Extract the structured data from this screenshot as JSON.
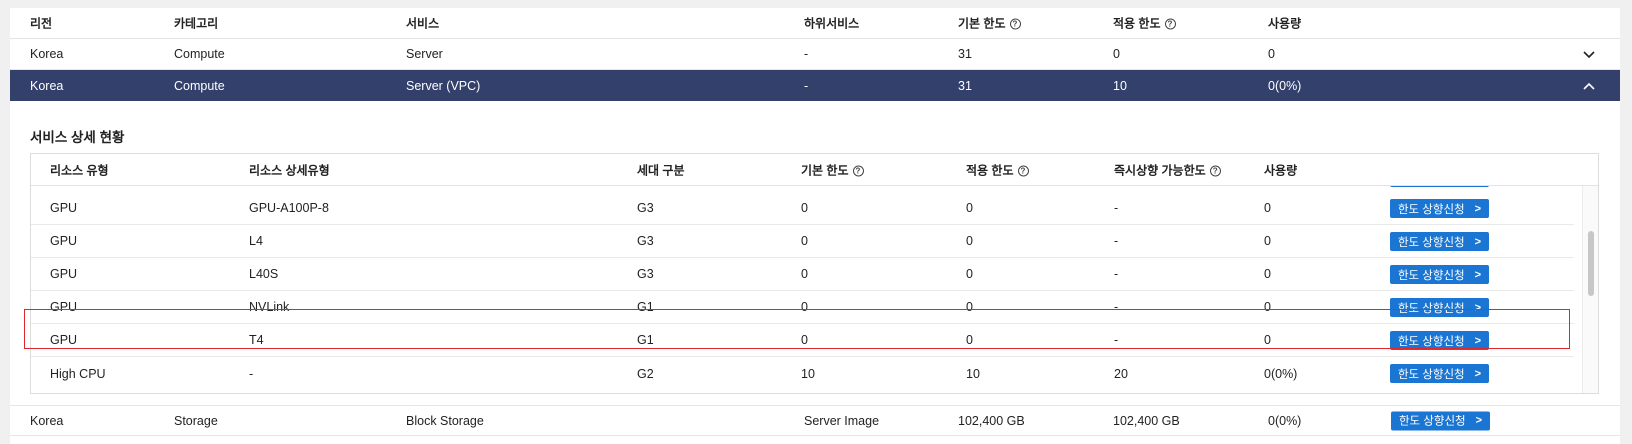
{
  "main_table": {
    "headers": {
      "region": "리전",
      "category": "카테고리",
      "service": "서비스",
      "sub_service": "하위서비스",
      "base_limit": "기본 한도",
      "applied_limit": "적용 한도",
      "usage": "사용량"
    },
    "rows": [
      {
        "region": "Korea",
        "category": "Compute",
        "service": "Server",
        "sub_service": "-",
        "base_limit": "31",
        "applied_limit": "0",
        "usage": "0",
        "expanded": false
      },
      {
        "region": "Korea",
        "category": "Compute",
        "service": "Server (VPC)",
        "sub_service": "-",
        "base_limit": "31",
        "applied_limit": "10",
        "usage": "0(0%)",
        "expanded": true
      },
      {
        "region": "Korea",
        "category": "Storage",
        "service": "Block Storage",
        "sub_service": "Server Image",
        "base_limit": "102,400 GB",
        "applied_limit": "102,400 GB",
        "usage": "0(0%)",
        "button": "한도 상향신청"
      }
    ]
  },
  "detail": {
    "title": "서비스 상세 현황",
    "headers": {
      "resource_type": "리소스 유형",
      "resource_subtype": "리소스 상세유형",
      "generation": "세대 구분",
      "base_limit": "기본 한도",
      "applied_limit": "적용 한도",
      "instant_limit": "즉시상향 가능한도",
      "usage": "사용량"
    },
    "rows": [
      {
        "resource_type": "GPU",
        "resource_subtype": "GPU-A100P-8",
        "generation": "G3",
        "base_limit": "0",
        "applied_limit": "0",
        "instant_limit": "-",
        "usage": "0",
        "button": "한도 상향신청"
      },
      {
        "resource_type": "GPU",
        "resource_subtype": "L4",
        "generation": "G3",
        "base_limit": "0",
        "applied_limit": "0",
        "instant_limit": "-",
        "usage": "0",
        "button": "한도 상향신청"
      },
      {
        "resource_type": "GPU",
        "resource_subtype": "L40S",
        "generation": "G3",
        "base_limit": "0",
        "applied_limit": "0",
        "instant_limit": "-",
        "usage": "0",
        "button": "한도 상향신청"
      },
      {
        "resource_type": "GPU",
        "resource_subtype": "NVLink",
        "generation": "G1",
        "base_limit": "0",
        "applied_limit": "0",
        "instant_limit": "-",
        "usage": "0",
        "button": "한도 상향신청"
      },
      {
        "resource_type": "GPU",
        "resource_subtype": "T4",
        "generation": "G1",
        "base_limit": "0",
        "applied_limit": "0",
        "instant_limit": "-",
        "usage": "0",
        "button": "한도 상향신청",
        "highlighted": true
      },
      {
        "resource_type": "High CPU",
        "resource_subtype": "-",
        "generation": "G2",
        "base_limit": "10",
        "applied_limit": "10",
        "instant_limit": "20",
        "usage": "0(0%)",
        "button": "한도 상향신청"
      }
    ]
  },
  "colors": {
    "selected_row_bg": "#33406b",
    "button_bg": "#1a76d2",
    "highlight_border": "#e0262b"
  },
  "icons": {
    "help": "help-circle-icon",
    "collapse": "chevron-up-icon",
    "expand": "chevron-down-icon",
    "button_arrow": "chevron-right-icon"
  }
}
